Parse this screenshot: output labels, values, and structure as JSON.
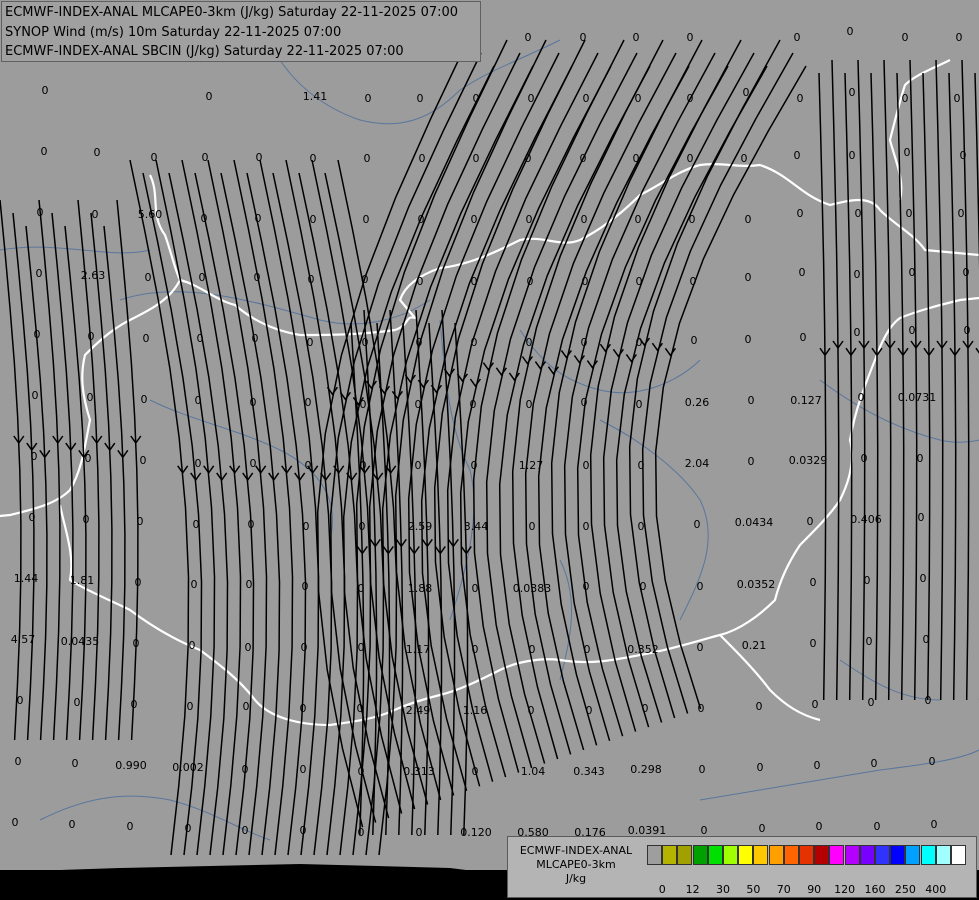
{
  "header": {
    "lines": [
      "ECMWF-INDEX-ANAL MLCAPE0-3km (J/kg) Saturday 22-11-2025 07:00",
      "SYNOP Wind (m/s) 10m Saturday 22-11-2025 07:00",
      "ECMWF-INDEX-ANAL SBCIN (J/kg) Saturday 22-11-2025 07:00"
    ]
  },
  "legend": {
    "title_lines": [
      "ECMWF-INDEX-ANAL",
      "MLCAPE0-3km",
      "J/kg"
    ],
    "colors": [
      "#9e9e9e",
      "#b4b400",
      "#a0a000",
      "#00a000",
      "#00e000",
      "#a0ff00",
      "#ffff00",
      "#ffc800",
      "#ffa000",
      "#ff6400",
      "#e63200",
      "#b40000",
      "#ff00ff",
      "#b400ff",
      "#7800ff",
      "#3232ff",
      "#0000ff",
      "#00a0ff",
      "#00ffff",
      "#a0ffff",
      "#ffffff"
    ],
    "ticks": [
      "0",
      "12",
      "30",
      "50",
      "70",
      "90",
      "120",
      "160",
      "250",
      "400"
    ],
    "tick_index": [
      1,
      3,
      5,
      7,
      9,
      11,
      13,
      15,
      17,
      19
    ]
  },
  "map": {
    "background": "#9c9c9c",
    "border_color": "#ffffff",
    "stream_color": "#000000",
    "values": [
      [
        "0",
        10,
        37
      ],
      [
        "0",
        70,
        37
      ],
      [
        "0",
        422,
        37
      ],
      [
        "0",
        528,
        37
      ],
      [
        "0",
        583,
        37
      ],
      [
        "0",
        636,
        37
      ],
      [
        "0",
        690,
        37
      ],
      [
        "0",
        797,
        37
      ],
      [
        "0",
        850,
        31
      ],
      [
        "0",
        905,
        37
      ],
      [
        "0",
        959,
        37
      ],
      [
        "0",
        45,
        90
      ],
      [
        "0",
        209,
        96
      ],
      [
        "1.41",
        315,
        96
      ],
      [
        "0",
        368,
        98
      ],
      [
        "0",
        420,
        98
      ],
      [
        "0",
        476,
        98
      ],
      [
        "0",
        531,
        98
      ],
      [
        "0",
        586,
        98
      ],
      [
        "0",
        638,
        98
      ],
      [
        "0",
        690,
        98
      ],
      [
        "0",
        746,
        92
      ],
      [
        "0",
        800,
        98
      ],
      [
        "0",
        852,
        92
      ],
      [
        "0",
        905,
        98
      ],
      [
        "0",
        957,
        98
      ],
      [
        "0",
        44,
        151
      ],
      [
        "0",
        97,
        152
      ],
      [
        "0",
        154,
        157
      ],
      [
        "0",
        205,
        157
      ],
      [
        "0",
        259,
        157
      ],
      [
        "0",
        313,
        158
      ],
      [
        "0",
        367,
        158
      ],
      [
        "0",
        422,
        158
      ],
      [
        "0",
        476,
        158
      ],
      [
        "0",
        528,
        158
      ],
      [
        "0",
        583,
        158
      ],
      [
        "0",
        636,
        158
      ],
      [
        "0",
        690,
        158
      ],
      [
        "0",
        744,
        158
      ],
      [
        "0",
        797,
        155
      ],
      [
        "0",
        852,
        155
      ],
      [
        "0",
        907,
        152
      ],
      [
        "0",
        963,
        155
      ],
      [
        "0",
        40,
        212
      ],
      [
        "0",
        95,
        214
      ],
      [
        "5.60",
        150,
        214
      ],
      [
        "0",
        204,
        218
      ],
      [
        "0",
        258,
        218
      ],
      [
        "0",
        313,
        219
      ],
      [
        "0",
        366,
        219
      ],
      [
        "0",
        421,
        219
      ],
      [
        "0",
        474,
        219
      ],
      [
        "0",
        529,
        219
      ],
      [
        "0",
        584,
        219
      ],
      [
        "0",
        638,
        219
      ],
      [
        "0",
        692,
        219
      ],
      [
        "0",
        748,
        219
      ],
      [
        "0",
        800,
        213
      ],
      [
        "0",
        858,
        213
      ],
      [
        "0",
        909,
        213
      ],
      [
        "0",
        961,
        213
      ],
      [
        "0",
        39,
        273
      ],
      [
        "2.63",
        93,
        275
      ],
      [
        "0",
        148,
        277
      ],
      [
        "0",
        202,
        277
      ],
      [
        "0",
        257,
        277
      ],
      [
        "0",
        311,
        279
      ],
      [
        "0",
        365,
        279
      ],
      [
        "0",
        420,
        281
      ],
      [
        "0",
        474,
        281
      ],
      [
        "0",
        530,
        281
      ],
      [
        "0",
        585,
        281
      ],
      [
        "0",
        639,
        281
      ],
      [
        "0",
        693,
        281
      ],
      [
        "0",
        748,
        277
      ],
      [
        "0",
        802,
        272
      ],
      [
        "0",
        857,
        274
      ],
      [
        "0",
        912,
        272
      ],
      [
        "0",
        966,
        272
      ],
      [
        "0",
        37,
        334
      ],
      [
        "0",
        91,
        336
      ],
      [
        "0",
        146,
        338
      ],
      [
        "0",
        200,
        338
      ],
      [
        "0",
        255,
        338
      ],
      [
        "0",
        310,
        342
      ],
      [
        "0",
        365,
        342
      ],
      [
        "0",
        419,
        342
      ],
      [
        "0",
        474,
        342
      ],
      [
        "0",
        529,
        342
      ],
      [
        "0",
        584,
        342
      ],
      [
        "0",
        639,
        342
      ],
      [
        "0",
        694,
        340
      ],
      [
        "0",
        748,
        339
      ],
      [
        "0",
        803,
        337
      ],
      [
        "0",
        857,
        332
      ],
      [
        "0",
        912,
        330
      ],
      [
        "0",
        967,
        330
      ],
      [
        "0",
        35,
        395
      ],
      [
        "0",
        90,
        397
      ],
      [
        "0",
        144,
        399
      ],
      [
        "0",
        198,
        400
      ],
      [
        "0",
        253,
        402
      ],
      [
        "0",
        308,
        402
      ],
      [
        "0",
        363,
        404
      ],
      [
        "0",
        418,
        404
      ],
      [
        "0",
        473,
        404
      ],
      [
        "0",
        529,
        404
      ],
      [
        "0",
        584,
        402
      ],
      [
        "0",
        639,
        404
      ],
      [
        "0.26",
        697,
        402
      ],
      [
        "0",
        751,
        400
      ],
      [
        "0.127",
        806,
        400
      ],
      [
        "0",
        861,
        397
      ],
      [
        "0.0731",
        917,
        397
      ],
      [
        "0",
        34,
        456
      ],
      [
        "0",
        88,
        458
      ],
      [
        "0",
        143,
        460
      ],
      [
        "0",
        198,
        463
      ],
      [
        "0",
        253,
        463
      ],
      [
        "0",
        308,
        465
      ],
      [
        "0",
        363,
        465
      ],
      [
        "0",
        418,
        465
      ],
      [
        "0",
        474,
        465
      ],
      [
        "1.27",
        531,
        465
      ],
      [
        "0",
        586,
        465
      ],
      [
        "0",
        641,
        465
      ],
      [
        "2.04",
        697,
        463
      ],
      [
        "0",
        751,
        461
      ],
      [
        "0.0329",
        808,
        460
      ],
      [
        "0",
        864,
        458
      ],
      [
        "0",
        920,
        458
      ],
      [
        "0",
        32,
        517
      ],
      [
        "0",
        86,
        519
      ],
      [
        "0",
        140,
        521
      ],
      [
        "0",
        196,
        524
      ],
      [
        "0",
        251,
        524
      ],
      [
        "0",
        306,
        526
      ],
      [
        "0",
        362,
        526
      ],
      [
        "2.59",
        420,
        526
      ],
      [
        "3.44",
        476,
        526
      ],
      [
        "0",
        532,
        526
      ],
      [
        "0",
        586,
        526
      ],
      [
        "0",
        641,
        526
      ],
      [
        "0",
        697,
        524
      ],
      [
        "0.0434",
        754,
        522
      ],
      [
        "0",
        810,
        521
      ],
      [
        "0.406",
        866,
        519
      ],
      [
        "0",
        921,
        517
      ],
      [
        "1.44",
        26,
        578
      ],
      [
        "1.81",
        82,
        580
      ],
      [
        "0",
        138,
        582
      ],
      [
        "0",
        194,
        584
      ],
      [
        "0",
        249,
        584
      ],
      [
        "0",
        305,
        586
      ],
      [
        "0",
        361,
        588
      ],
      [
        "1.88",
        420,
        588
      ],
      [
        "0",
        475,
        588
      ],
      [
        "0.0383",
        532,
        588
      ],
      [
        "0",
        586,
        586
      ],
      [
        "0",
        643,
        586
      ],
      [
        "0",
        700,
        586
      ],
      [
        "0.0352",
        756,
        584
      ],
      [
        "0",
        813,
        582
      ],
      [
        "0",
        867,
        580
      ],
      [
        "0",
        923,
        578
      ],
      [
        "4.57",
        23,
        639
      ],
      [
        "0.0435",
        80,
        641
      ],
      [
        "0",
        136,
        643
      ],
      [
        "0",
        192,
        645
      ],
      [
        "0",
        248,
        647
      ],
      [
        "0",
        304,
        647
      ],
      [
        "0",
        361,
        647
      ],
      [
        "1.17",
        418,
        649
      ],
      [
        "0",
        475,
        649
      ],
      [
        "0",
        532,
        649
      ],
      [
        "0",
        587,
        649
      ],
      [
        "0.352",
        643,
        649
      ],
      [
        "0",
        700,
        647
      ],
      [
        "0.21",
        754,
        645
      ],
      [
        "0",
        813,
        643
      ],
      [
        "0",
        869,
        641
      ],
      [
        "0",
        926,
        639
      ],
      [
        "0",
        20,
        700
      ],
      [
        "0",
        77,
        702
      ],
      [
        "0",
        134,
        704
      ],
      [
        "0",
        190,
        706
      ],
      [
        "0",
        246,
        706
      ],
      [
        "0",
        303,
        708
      ],
      [
        "0",
        360,
        708
      ],
      [
        "2.49",
        418,
        710
      ],
      [
        "1.16",
        475,
        710
      ],
      [
        "0",
        531,
        710
      ],
      [
        "0",
        589,
        710
      ],
      [
        "0",
        645,
        708
      ],
      [
        "0",
        701,
        708
      ],
      [
        "0",
        759,
        706
      ],
      [
        "0",
        815,
        704
      ],
      [
        "0",
        871,
        702
      ],
      [
        "0",
        928,
        700
      ],
      [
        "0",
        18,
        761
      ],
      [
        "0",
        75,
        763
      ],
      [
        "0.990",
        131,
        765
      ],
      [
        "0.002",
        188,
        767
      ],
      [
        "0",
        245,
        769
      ],
      [
        "0",
        303,
        769
      ],
      [
        "0",
        361,
        771
      ],
      [
        "0.313",
        419,
        771
      ],
      [
        "0",
        475,
        771
      ],
      [
        "1.04",
        533,
        771
      ],
      [
        "0.343",
        589,
        771
      ],
      [
        "0.298",
        646,
        769
      ],
      [
        "0",
        702,
        769
      ],
      [
        "0",
        760,
        767
      ],
      [
        "0",
        817,
        765
      ],
      [
        "0",
        874,
        763
      ],
      [
        "0",
        932,
        761
      ],
      [
        "0",
        15,
        822
      ],
      [
        "0",
        72,
        824
      ],
      [
        "0",
        130,
        826
      ],
      [
        "0",
        188,
        828
      ],
      [
        "0",
        245,
        830
      ],
      [
        "0",
        303,
        830
      ],
      [
        "0",
        361,
        832
      ],
      [
        "0",
        419,
        832
      ],
      [
        "0.120",
        476,
        832
      ],
      [
        "0.580",
        533,
        832
      ],
      [
        "0.176",
        590,
        832
      ],
      [
        "0.0391",
        647,
        830
      ],
      [
        "0",
        704,
        830
      ],
      [
        "0",
        762,
        828
      ],
      [
        "0",
        819,
        826
      ],
      [
        "0",
        877,
        826
      ],
      [
        "0",
        934,
        824
      ]
    ]
  }
}
